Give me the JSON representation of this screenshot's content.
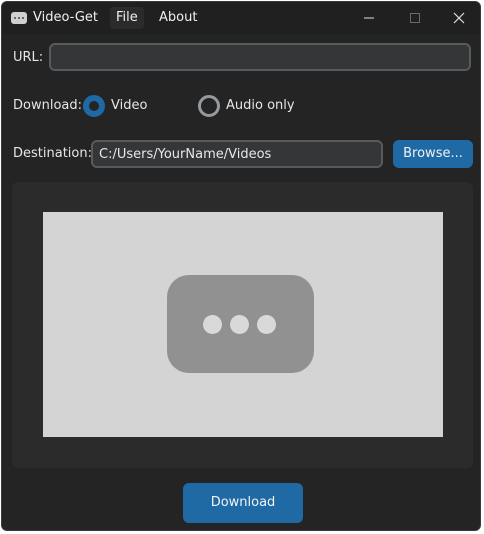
{
  "window": {
    "title": "Video-Get",
    "app_icon": "app-window-icon",
    "controls": {
      "minimize": "minimize-icon",
      "maximize": "maximize-icon",
      "close": "close-icon"
    }
  },
  "menu": {
    "items": [
      {
        "label": "File",
        "active": true
      },
      {
        "label": "About",
        "active": false
      }
    ]
  },
  "form": {
    "url_label": "URL:",
    "url_value": "",
    "download_label": "Download:",
    "options": [
      {
        "label": "Video",
        "selected": true
      },
      {
        "label": "Audio only",
        "selected": false
      }
    ],
    "destination_label": "Destination:",
    "destination_value": "C:/Users/YourName/Videos",
    "browse_label": "Browse..."
  },
  "preview": {
    "placeholder_icon": "video-placeholder-icon"
  },
  "actions": {
    "download_label": "Download"
  },
  "colors": {
    "accent": "#1f6aa5",
    "background": "#242424",
    "titlebar": "#202020",
    "input_bg": "#343638",
    "input_border": "#565b5e",
    "preview_frame": "#2b2b2b",
    "preview_bg": "#d4d4d4"
  }
}
